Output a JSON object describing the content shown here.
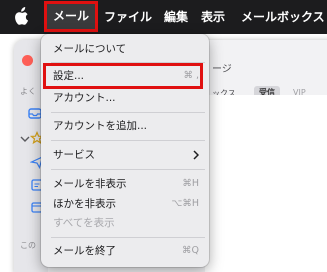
{
  "menubar": {
    "items": [
      {
        "label": "メール"
      },
      {
        "label": "ファイル"
      },
      {
        "label": "編集"
      },
      {
        "label": "表示"
      },
      {
        "label": "メールボックス"
      }
    ]
  },
  "background": {
    "toolbar_partial": "ージ",
    "filter_partial": "ックス",
    "filter_selected": "受信",
    "filter_vip": "VIP",
    "sidebar_label_top": "よく",
    "sidebar_label_bottom": "この"
  },
  "mail_menu": {
    "items": [
      {
        "label": "メールについて",
        "shortcut": ""
      },
      {
        "label": "設定...",
        "shortcut": "⌘ ,"
      },
      {
        "label": "アカウント...",
        "shortcut": ""
      },
      {
        "label": "アカウントを追加...",
        "shortcut": ""
      },
      {
        "label": "サービス",
        "shortcut": ""
      },
      {
        "label": "メールを非表示",
        "shortcut": "⌘H"
      },
      {
        "label": "ほかを非表示",
        "shortcut": "⌥⌘H"
      },
      {
        "label": "すべてを表示",
        "shortcut": ""
      },
      {
        "label": "メールを終了",
        "shortcut": "⌘Q"
      }
    ]
  },
  "colors": {
    "highlight_red": "#e01010",
    "menubar_bg": "#1c1c1e",
    "close_button": "#fe5f57"
  }
}
